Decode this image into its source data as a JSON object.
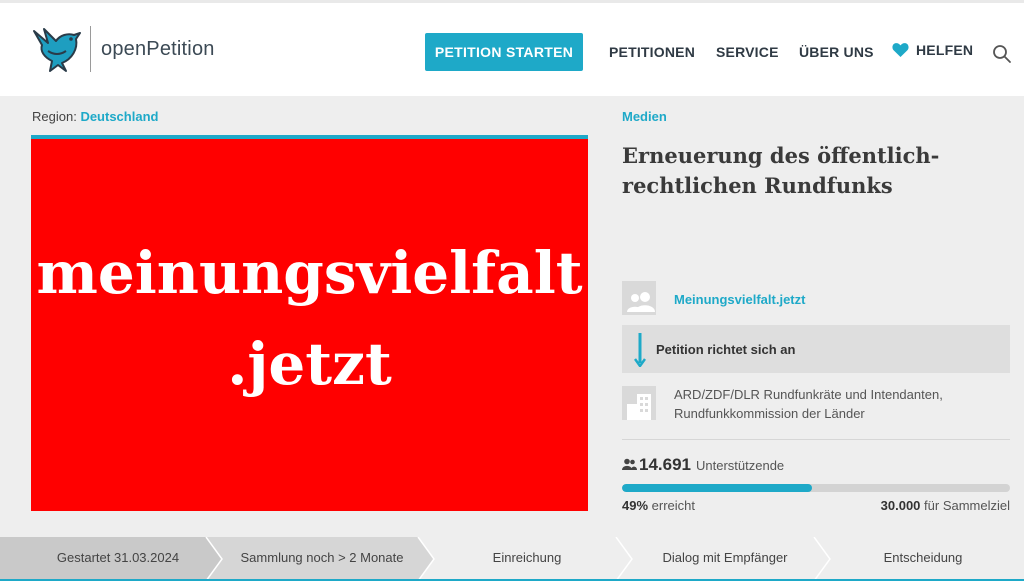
{
  "header": {
    "logo_text": "openPetition",
    "start_button": "PETITION STARTEN",
    "nav": [
      "PETITIONEN",
      "SERVICE",
      "ÜBER UNS"
    ],
    "help": "HELFEN",
    "icons": [
      "bird-logo-icon",
      "heart-icon",
      "search-icon"
    ]
  },
  "petition": {
    "region_label": "Region:",
    "region_value": "Deutschland",
    "image_text_line1": "meinungsvielfalt",
    "image_text_line2": ".jetzt",
    "category": "Medien",
    "title": "Erneuerung des öffentlich-rechtlichen Rundfunks",
    "author": "Meinungsvielfalt.jetzt",
    "addressed_label": "Petition richtet sich an",
    "recipient": "ARD/ZDF/DLR Rundfunkräte und Intendanten, Rundfunkkommission der Länder",
    "supporters_count": "14.691",
    "supporters_label": "Unterstützende",
    "progress_fraction": 0.49,
    "percent": "49%",
    "percent_label": "erreicht",
    "goal": "30.000",
    "goal_label": "für Sammelziel"
  },
  "steps": [
    {
      "label": "Gestartet 31.03.2024",
      "state": "done"
    },
    {
      "label": "Sammlung noch > 2 Monate",
      "state": "current"
    },
    {
      "label": "Einreichung",
      "state": "todo"
    },
    {
      "label": "Dialog mit Empfänger",
      "state": "todo"
    },
    {
      "label": "Entscheidung",
      "state": "todo"
    }
  ],
  "colors": {
    "accent": "#1ea9c8",
    "image_background": "#ff0000",
    "page_background": "#eeeeee",
    "step_done": "#c9c9c9",
    "step_current": "#d6d6d6",
    "step_todo": "#eeeeee"
  }
}
